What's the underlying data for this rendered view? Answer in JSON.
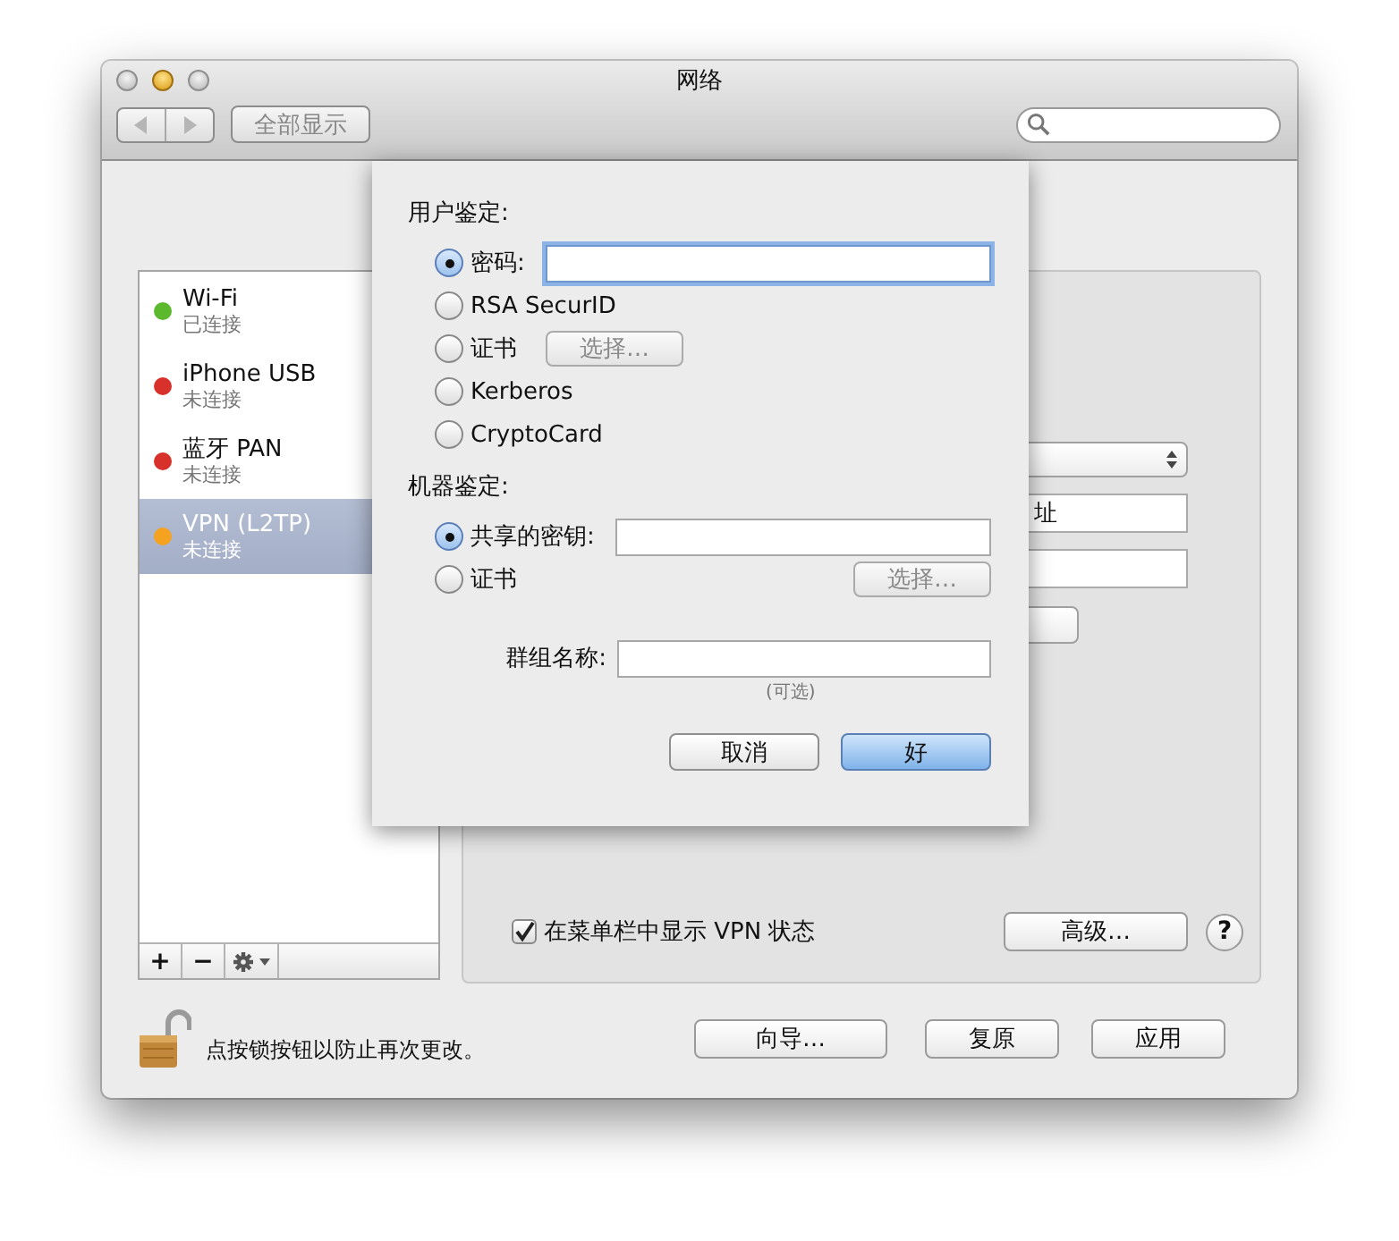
{
  "window": {
    "title": "网络",
    "show_all": "全部显示"
  },
  "sidebar": {
    "items": [
      {
        "name": "Wi-Fi",
        "status": "已连接",
        "color": "#5cb82c",
        "selected": false
      },
      {
        "name": "iPhone USB",
        "status": "未连接",
        "color": "#d8302a",
        "selected": false
      },
      {
        "name": "蓝牙 PAN",
        "status": "未连接",
        "color": "#d8302a",
        "selected": false
      },
      {
        "name": "VPN (L2TP)",
        "status": "未连接",
        "color": "#f4a21f",
        "selected": true
      }
    ],
    "tools": [
      "+",
      "−"
    ]
  },
  "panel": {
    "controls": [
      {
        "kind": "popup"
      },
      {
        "kind": "field",
        "value": "址"
      },
      {
        "kind": "field"
      },
      {
        "kind": "button"
      }
    ],
    "show_status": {
      "label": "在菜单栏中显示 VPN 状态",
      "checked": true
    },
    "advanced": "高级…",
    "help": "?"
  },
  "footer": {
    "lock_text": "点按锁按钮以防止再次更改。",
    "buttons": [
      {
        "label": "向导…"
      },
      {
        "label": "复原"
      },
      {
        "label": "应用"
      }
    ]
  },
  "sheet": {
    "user_auth": {
      "heading": "用户鉴定:",
      "options": [
        {
          "label": "密码:",
          "selected": true,
          "kind": "field",
          "focused": true
        },
        {
          "label": "RSA SecurID",
          "selected": false,
          "kind": "plain"
        },
        {
          "label": "证书",
          "selected": false,
          "kind": "choose",
          "button": "选择…"
        },
        {
          "label": "Kerberos",
          "selected": false,
          "kind": "plain"
        },
        {
          "label": "CryptoCard",
          "selected": false,
          "kind": "plain"
        }
      ]
    },
    "machine_auth": {
      "heading": "机器鉴定:",
      "options": [
        {
          "label": "共享的密钥:",
          "selected": true,
          "kind": "field",
          "focused": false
        },
        {
          "label": "证书",
          "selected": false,
          "kind": "choose_right",
          "button": "选择…"
        }
      ]
    },
    "group_name": {
      "label": "群组名称:",
      "hint": "(可选)"
    },
    "buttons": [
      {
        "label": "取消",
        "default": false
      },
      {
        "label": "好",
        "default": true
      }
    ]
  }
}
